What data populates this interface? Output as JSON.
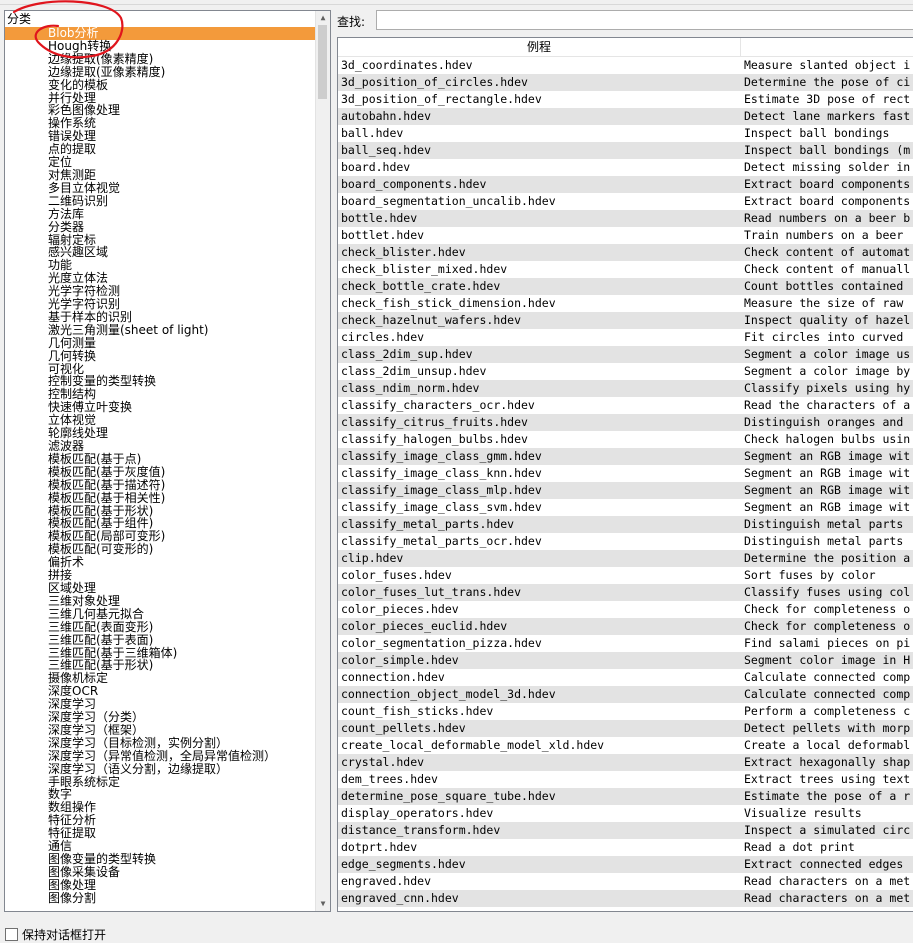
{
  "left_panel": {
    "header": "分类",
    "categories": [
      "Blob分析",
      "Hough转换",
      "边缘提取(像素精度)",
      "边缘提取(亚像素精度)",
      "变化的模板",
      "并行处理",
      "彩色图像处理",
      "操作系统",
      "错误处理",
      "点的提取",
      "定位",
      "对焦测距",
      "多目立体视觉",
      "二维码识别",
      "方法库",
      "分类器",
      "辐射定标",
      "感兴趣区域",
      "功能",
      "光度立体法",
      "光学字符检测",
      "光学字符识别",
      "基于样本的识别",
      "激光三角测量(sheet of light)",
      "几何测量",
      "几何转换",
      "可视化",
      "控制变量的类型转换",
      "控制结构",
      "快速傅立叶变换",
      "立体视觉",
      "轮廓线处理",
      "滤波器",
      "模板匹配(基于点)",
      "模板匹配(基于灰度值)",
      "模板匹配(基于描述符)",
      "模板匹配(基于相关性)",
      "模板匹配(基于形状)",
      "模板匹配(基于组件)",
      "模板匹配(局部可变形)",
      "模板匹配(可变形的)",
      "偏折术",
      "拼接",
      "区域处理",
      "三维对象处理",
      "三维几何基元拟合",
      "三维匹配(表面变形)",
      "三维匹配(基于表面)",
      "三维匹配(基于三维箱体)",
      "三维匹配(基于形状)",
      "摄像机标定",
      "深度OCR",
      "深度学习",
      "深度学习（分类）",
      "深度学习（框架）",
      "深度学习（目标检测，实例分割）",
      "深度学习（异常值检测，全局异常值检测）",
      "深度学习（语义分割，边缘提取）",
      "手眼系统标定",
      "数字",
      "数组操作",
      "特征分析",
      "特征提取",
      "通信",
      "图像变量的类型转换",
      "图像采集设备",
      "图像处理",
      "图像分割"
    ],
    "selected_index": 0
  },
  "search": {
    "label": "查找:",
    "value": ""
  },
  "table": {
    "col1_header": "例程",
    "col2_header": "",
    "rows": [
      [
        "3d_coordinates.hdev",
        "Measure slanted object i"
      ],
      [
        "3d_position_of_circles.hdev",
        "Determine the pose of ci"
      ],
      [
        "3d_position_of_rectangle.hdev",
        "Estimate 3D pose of rect"
      ],
      [
        "autobahn.hdev",
        "Detect lane markers fast"
      ],
      [
        "ball.hdev",
        "Inspect ball bondings"
      ],
      [
        "ball_seq.hdev",
        "Inspect ball bondings (m"
      ],
      [
        "board.hdev",
        "Detect missing solder in"
      ],
      [
        "board_components.hdev",
        "Extract board components"
      ],
      [
        "board_segmentation_uncalib.hdev",
        "Extract board components"
      ],
      [
        "bottle.hdev",
        "Read numbers on a beer b"
      ],
      [
        "bottlet.hdev",
        "Train numbers on a beer"
      ],
      [
        "check_blister.hdev",
        "Check content of automat"
      ],
      [
        "check_blister_mixed.hdev",
        "Check content of manuall"
      ],
      [
        "check_bottle_crate.hdev",
        "Count bottles contained"
      ],
      [
        "check_fish_stick_dimension.hdev",
        "Measure the size of raw"
      ],
      [
        "check_hazelnut_wafers.hdev",
        "Inspect quality of hazel"
      ],
      [
        "circles.hdev",
        "Fit circles into curved"
      ],
      [
        "class_2dim_sup.hdev",
        "Segment a color image us"
      ],
      [
        "class_2dim_unsup.hdev",
        "Segment a color image by"
      ],
      [
        "class_ndim_norm.hdev",
        "Classify pixels using hy"
      ],
      [
        "classify_characters_ocr.hdev",
        "Read the characters of a"
      ],
      [
        "classify_citrus_fruits.hdev",
        "Distinguish oranges and"
      ],
      [
        "classify_halogen_bulbs.hdev",
        "Check halogen bulbs usin"
      ],
      [
        "classify_image_class_gmm.hdev",
        "Segment an RGB image wit"
      ],
      [
        "classify_image_class_knn.hdev",
        "Segment an RGB image wit"
      ],
      [
        "classify_image_class_mlp.hdev",
        "Segment an RGB image wit"
      ],
      [
        "classify_image_class_svm.hdev",
        "Segment an RGB image wit"
      ],
      [
        "classify_metal_parts.hdev",
        "Distinguish metal parts"
      ],
      [
        "classify_metal_parts_ocr.hdev",
        "Distinguish metal parts"
      ],
      [
        "clip.hdev",
        "Determine the position a"
      ],
      [
        "color_fuses.hdev",
        "Sort fuses by color"
      ],
      [
        "color_fuses_lut_trans.hdev",
        "Classify fuses using col"
      ],
      [
        "color_pieces.hdev",
        "Check for completeness o"
      ],
      [
        "color_pieces_euclid.hdev",
        "Check for completeness o"
      ],
      [
        "color_segmentation_pizza.hdev",
        "Find salami pieces on pi"
      ],
      [
        "color_simple.hdev",
        "Segment color image in H"
      ],
      [
        "connection.hdev",
        "Calculate connected comp"
      ],
      [
        "connection_object_model_3d.hdev",
        "Calculate connected comp"
      ],
      [
        "count_fish_sticks.hdev",
        "Perform a completeness c"
      ],
      [
        "count_pellets.hdev",
        "Detect pellets with morp"
      ],
      [
        "create_local_deformable_model_xld.hdev",
        "Create a local deformabl"
      ],
      [
        "crystal.hdev",
        "Extract hexagonally shap"
      ],
      [
        "dem_trees.hdev",
        "Extract trees using text"
      ],
      [
        "determine_pose_square_tube.hdev",
        "Estimate the pose of a r"
      ],
      [
        "display_operators.hdev",
        "Visualize results"
      ],
      [
        "distance_transform.hdev",
        "Inspect a simulated circ"
      ],
      [
        "dotprt.hdev",
        "Read a dot print"
      ],
      [
        "edge_segments.hdev",
        "Extract connected edges"
      ],
      [
        "engraved.hdev",
        "Read characters on a met"
      ],
      [
        "engraved_cnn.hdev",
        "Read characters on a met"
      ]
    ]
  },
  "footer": {
    "checkbox_label": "保持对话框打开",
    "checked": false
  },
  "colors": {
    "selected_bg": "#f39a3b",
    "alt_row_bg": "#e3e3e3",
    "annotation": "#e0151d"
  }
}
